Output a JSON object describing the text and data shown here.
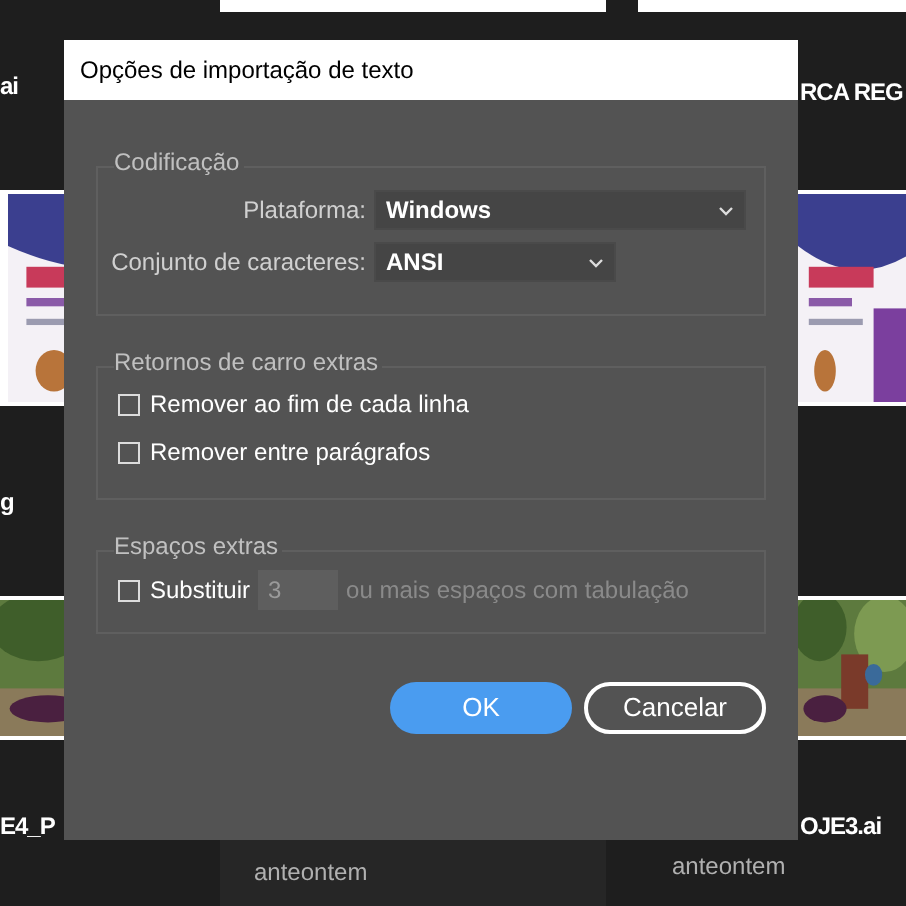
{
  "background": {
    "left_names": [
      "ai",
      "g",
      "E4_P"
    ],
    "right_names": [
      "RCA REG",
      "OJE3.ai"
    ],
    "dates": [
      "anteontem",
      "anteontem"
    ]
  },
  "dialog": {
    "title": "Opções de importação de texto",
    "encoding": {
      "legend": "Codificação",
      "platform": {
        "label": "Plataforma:",
        "value": "Windows"
      },
      "charset": {
        "label": "Conjunto de caracteres:",
        "value": "ANSI"
      }
    },
    "line_breaks": {
      "legend": "Retornos de carro extras",
      "options": [
        {
          "label": "Remover ao fim de cada linha",
          "checked": false
        },
        {
          "label": "Remover entre parágrafos",
          "checked": false
        }
      ]
    },
    "spaces": {
      "legend": "Espaços extras",
      "replace": {
        "label": "Substituir",
        "checked": false,
        "count": "3",
        "suffix": "ou mais espaços com tabulação",
        "disabled": true
      }
    },
    "buttons": [
      {
        "label": "OK",
        "kind": "primary"
      },
      {
        "label": "Cancelar",
        "kind": "secondary"
      }
    ]
  }
}
